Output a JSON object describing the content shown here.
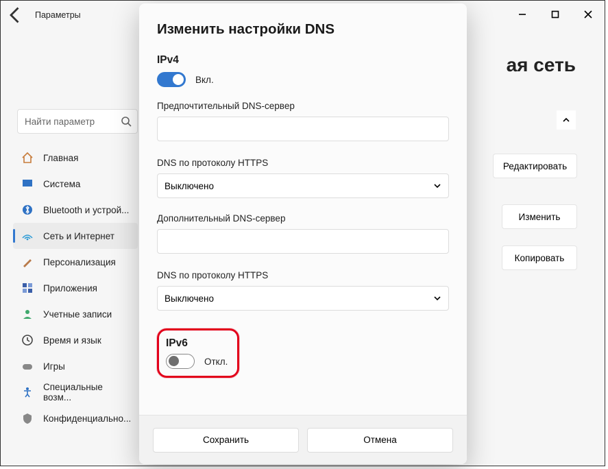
{
  "window": {
    "title": "Параметры",
    "controls": {
      "min": "minimize",
      "max": "maximize",
      "close": "close"
    }
  },
  "background": {
    "heading_partial": "ая сеть",
    "edit_btn": "Редактировать",
    "change_btn": "Изменить",
    "copy_btn": "Копировать"
  },
  "search": {
    "placeholder": "Найти параметр"
  },
  "sidebar": {
    "items": [
      {
        "icon": "home-icon",
        "label": "Главная"
      },
      {
        "icon": "system-icon",
        "label": "Система"
      },
      {
        "icon": "bluetooth-icon",
        "label": "Bluetooth и устрой..."
      },
      {
        "icon": "network-icon",
        "label": "Сеть и Интернет"
      },
      {
        "icon": "personalize-icon",
        "label": "Персонализация"
      },
      {
        "icon": "apps-icon",
        "label": "Приложения"
      },
      {
        "icon": "accounts-icon",
        "label": "Учетные записи"
      },
      {
        "icon": "time-icon",
        "label": "Время и язык"
      },
      {
        "icon": "gaming-icon",
        "label": "Игры"
      },
      {
        "icon": "accessibility-icon",
        "label": "Специальные возм..."
      },
      {
        "icon": "privacy-icon",
        "label": "Конфиденциально..."
      }
    ],
    "active_index": 3
  },
  "modal": {
    "title": "Изменить настройки DNS",
    "ipv4": {
      "heading": "IPv4",
      "toggle_state": "on",
      "toggle_label": "Вкл.",
      "preferred_label": "Предпочтительный DNS-сервер",
      "preferred_value": "",
      "doh1_label": "DNS по протоколу HTTPS",
      "doh1_value": "Выключено",
      "alternate_label": "Дополнительный DNS-сервер",
      "alternate_value": "",
      "doh2_label": "DNS по протоколу HTTPS",
      "doh2_value": "Выключено"
    },
    "ipv6": {
      "heading": "IPv6",
      "toggle_state": "off",
      "toggle_label": "Откл."
    },
    "footer": {
      "save": "Сохранить",
      "cancel": "Отмена"
    }
  }
}
